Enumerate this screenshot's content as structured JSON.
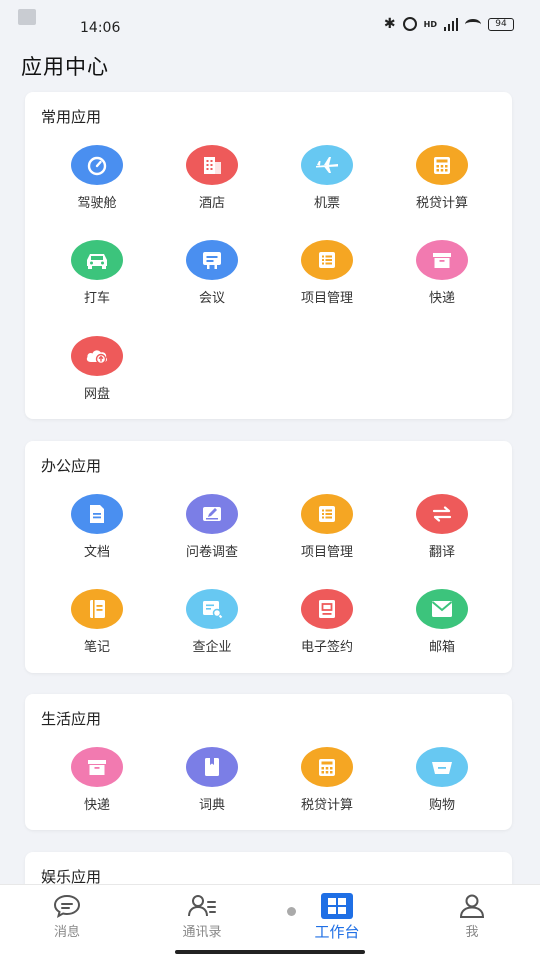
{
  "status_bar": {
    "time": "14:06",
    "battery": "94",
    "network": "HD"
  },
  "page_title": "应用中心",
  "sections": {
    "common": {
      "title": "常用应用",
      "apps": [
        {
          "label": "驾驶舱",
          "icon": "dashboard-icon",
          "color": "#4a8ff0"
        },
        {
          "label": "酒店",
          "icon": "hotel-building-icon",
          "color": "#ee5a5a"
        },
        {
          "label": "机票",
          "icon": "airplane-icon",
          "color": "#67c8f2"
        },
        {
          "label": "税贷计算",
          "icon": "calculator-icon",
          "color": "#f5a623"
        },
        {
          "label": "打车",
          "icon": "car-icon",
          "color": "#3cc47c"
        },
        {
          "label": "会议",
          "icon": "meeting-screen-icon",
          "color": "#4a8ff0"
        },
        {
          "label": "项目管理",
          "icon": "project-list-icon",
          "color": "#f5a623"
        },
        {
          "label": "快递",
          "icon": "package-box-icon",
          "color": "#f27ab0"
        },
        {
          "label": "网盘",
          "icon": "cloud-upload-icon",
          "color": "#ee5a5a"
        }
      ]
    },
    "office": {
      "title": "办公应用",
      "apps": [
        {
          "label": "文档",
          "icon": "document-icon",
          "color": "#4a8ff0"
        },
        {
          "label": "问卷调查",
          "icon": "survey-edit-icon",
          "color": "#7b7ee6"
        },
        {
          "label": "项目管理",
          "icon": "project-list-icon",
          "color": "#f5a623"
        },
        {
          "label": "翻译",
          "icon": "translate-arrows-icon",
          "color": "#ee5a5a"
        },
        {
          "label": "笔记",
          "icon": "notebook-icon",
          "color": "#f5a623"
        },
        {
          "label": "查企业",
          "icon": "company-search-icon",
          "color": "#67c8f2"
        },
        {
          "label": "电子签约",
          "icon": "e-sign-icon",
          "color": "#ee5a5a"
        },
        {
          "label": "邮箱",
          "icon": "mail-icon",
          "color": "#3cc47c"
        }
      ]
    },
    "life": {
      "title": "生活应用",
      "apps": [
        {
          "label": "快递",
          "icon": "package-box-icon",
          "color": "#f27ab0"
        },
        {
          "label": "词典",
          "icon": "dictionary-icon",
          "color": "#7b7ee6"
        },
        {
          "label": "税贷计算",
          "icon": "calculator-icon",
          "color": "#f5a623"
        },
        {
          "label": "购物",
          "icon": "shopping-basket-icon",
          "color": "#67c8f2"
        }
      ]
    },
    "entertainment": {
      "title": "娱乐应用"
    }
  },
  "tabbar": {
    "messages": "消息",
    "contacts": "通讯录",
    "workbench": "工作台",
    "me": "我",
    "active_color": "#1f6fe5"
  }
}
